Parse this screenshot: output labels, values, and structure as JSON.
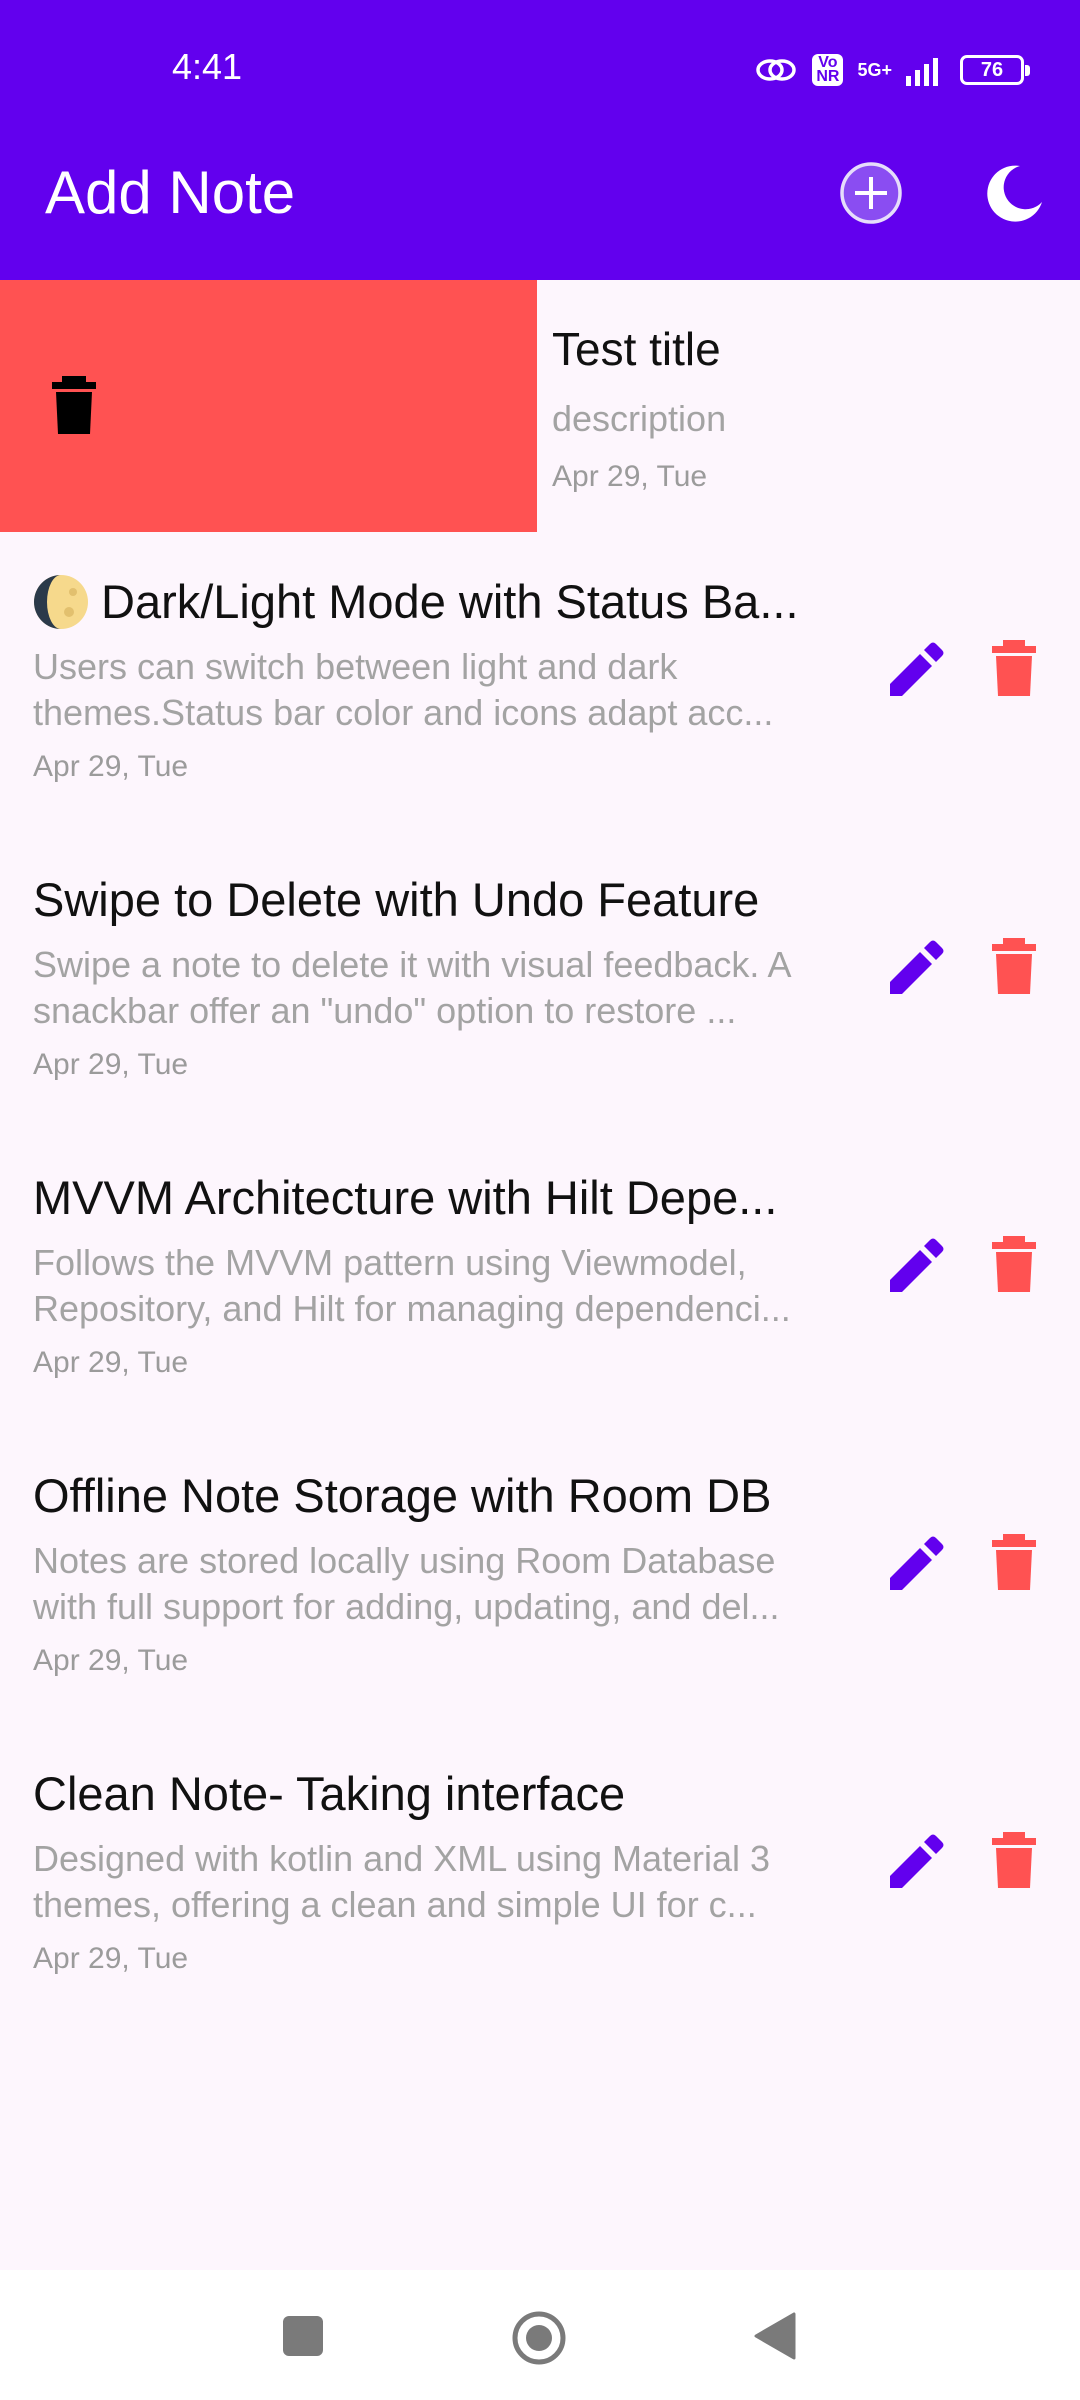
{
  "status_bar": {
    "time": "4:41",
    "volte_label": "Vo\nNR",
    "network_label": "5G+",
    "battery_level": "76"
  },
  "app_bar": {
    "title": "Add Note",
    "add_icon": "add-circle-icon",
    "theme_icon": "moon-icon"
  },
  "swiped_note": {
    "title": "Test title",
    "description": "description",
    "date": "Apr 29, Tue",
    "swipe_icon": "delete-icon",
    "swipe_color": "#FF5252"
  },
  "notes": [
    {
      "emoji_icon": "moon-emoji-icon",
      "title": "Dark/Light Mode with Status Ba...",
      "description": "Users can switch between light and dark themes.Status bar color and icons adapt acc...",
      "date": "Apr 29, Tue"
    },
    {
      "title": "Swipe to Delete with Undo Feature",
      "description": "Swipe a note to delete it with visual feedback. A snackbar offer an \"undo\" option to restore ...",
      "date": "Apr 29, Tue"
    },
    {
      "title": "MVVM Architecture with Hilt Depe...",
      "description": "Follows the MVVM pattern using Viewmodel, Repository, and Hilt for managing dependenci...",
      "date": "Apr 29, Tue"
    },
    {
      "title": "Offline Note Storage with Room DB",
      "description": "Notes are stored locally using Room Database with full support for adding, updating, and del...",
      "date": "Apr 29, Tue"
    },
    {
      "title": "Clean Note- Taking interface",
      "description": "Designed with kotlin and XML using Material 3 themes, offering a clean and simple UI for c...",
      "date": "Apr 29, Tue"
    }
  ],
  "colors": {
    "primary": "#6200EE",
    "delete": "#FF5252",
    "background": "#FDF6FD"
  },
  "nav_bar": {
    "recent_icon": "square-icon",
    "home_icon": "circle-icon",
    "back_icon": "triangle-back-icon"
  }
}
